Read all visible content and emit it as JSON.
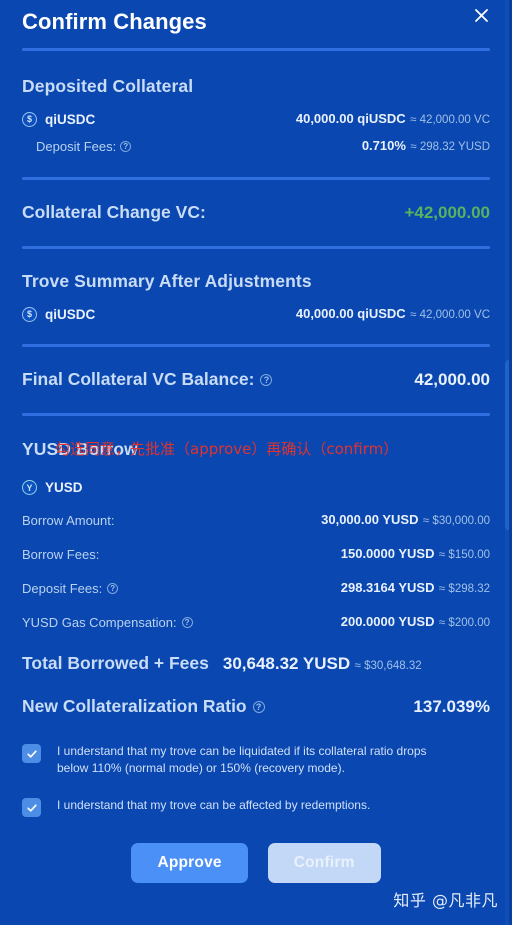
{
  "dialog": {
    "title": "Confirm Changes",
    "close_label": "✕"
  },
  "deposited_collateral": {
    "section_title": "Deposited Collateral",
    "asset": {
      "icon": "coin-icon-qiusdc",
      "name": "qiUSDC",
      "amount": "40,000.00 qiUSDC",
      "approx": "≈ 42,000.00 VC"
    },
    "deposit_fees": {
      "label": "Deposit Fees:",
      "info_icon": "?",
      "value": "0.710%",
      "approx": "≈ 298.32 YUSD"
    }
  },
  "collateral_change": {
    "label": "Collateral Change VC:",
    "value": "+42,000.00",
    "value_color": "#56b35f"
  },
  "trove_summary": {
    "section_title": "Trove Summary After Adjustments",
    "asset": {
      "icon": "coin-icon-qiusdc",
      "name": "qiUSDC",
      "amount": "40,000.00 qiUSDC",
      "approx": "≈ 42,000.00 VC"
    }
  },
  "final_collateral": {
    "label": "Final Collateral VC Balance:",
    "info_icon": "?",
    "value": "42,000.00"
  },
  "yusd_borrow": {
    "section_title": "YUSD Borrow",
    "annotation_cn": "勾选同意，先批准（approve）再确认（confirm）",
    "annotation_color": "#e0332f",
    "token": {
      "icon": "coin-icon-yusd",
      "name": "YUSD"
    },
    "rows": [
      {
        "label": "Borrow Amount:",
        "has_info": false,
        "value": "30,000.00 YUSD",
        "approx": "≈ $30,000.00"
      },
      {
        "label": "Borrow Fees:",
        "has_info": false,
        "value": "150.0000 YUSD",
        "approx": "≈ $150.00"
      },
      {
        "label": "Deposit Fees:",
        "has_info": true,
        "value": "298.3164 YUSD",
        "approx": "≈ $298.32"
      },
      {
        "label": "YUSD Gas Compensation:",
        "has_info": true,
        "value": "200.0000 YUSD",
        "approx": "≈ $200.00"
      }
    ]
  },
  "total_borrowed": {
    "label": "Total Borrowed + Fees",
    "value": "30,648.32 YUSD",
    "approx": "≈ $30,648.32"
  },
  "new_collat_ratio": {
    "label": "New Collateralization Ratio",
    "info_icon": "?",
    "value": "137.039%"
  },
  "checkboxes": [
    {
      "checked": true,
      "text": "I understand that my trove can be liquidated if its collateral ratio drops below 110% (normal mode) or 150% (recovery mode)."
    },
    {
      "checked": true,
      "text": "I understand that my trove can be affected by redemptions."
    }
  ],
  "actions": {
    "approve_label": "Approve",
    "confirm_label": "Confirm"
  },
  "watermark": "知乎 @凡非凡",
  "colors": {
    "background": "#0a47b0",
    "rule": "#2f6fe0",
    "accent_green": "#56b35f",
    "approve_button": "#4a90f7",
    "confirm_button": "#c3d8f6",
    "checkbox": "#4c8de6",
    "annotation_red": "#e0332f"
  }
}
